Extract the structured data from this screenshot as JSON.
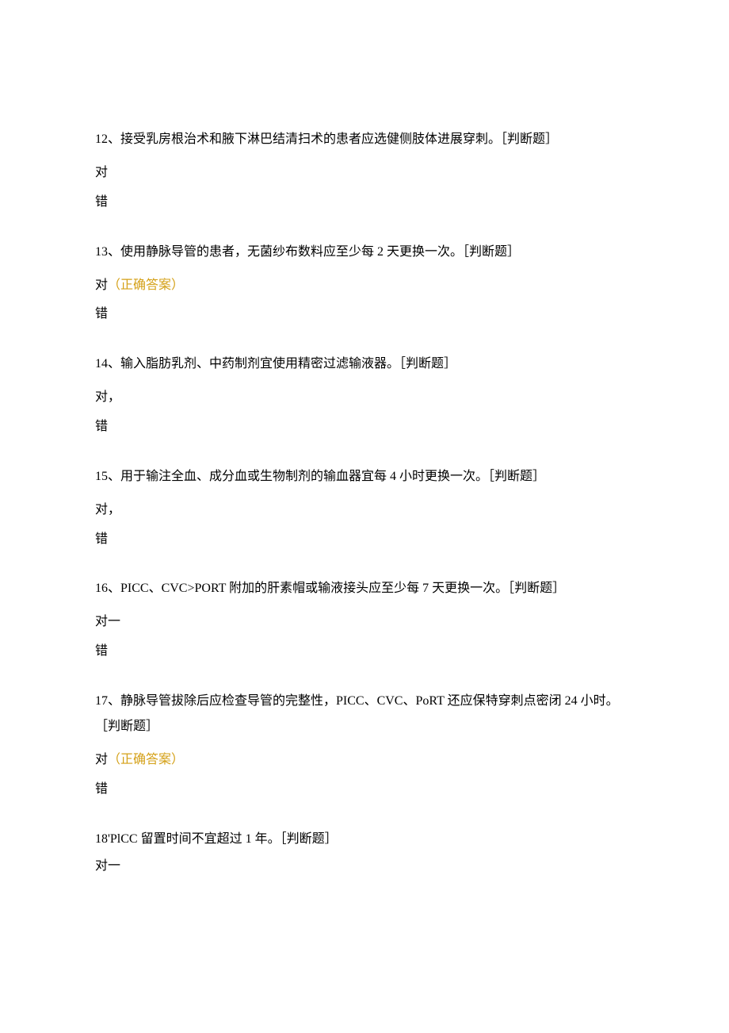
{
  "q12": {
    "text": "12、接受乳房根治术和腋下淋巴结清扫术的患者应选健侧肢体进展穿刺。［判断题］",
    "opt_true": "对",
    "opt_false": "错"
  },
  "q13": {
    "text": "13、使用静脉导管的患者，无菌纱布数料应至少每 2 天更换一次。［判断题］",
    "opt_true": "对",
    "correct": "（正确答案）",
    "opt_false": "错"
  },
  "q14": {
    "text": "14、输入脂肪乳剂、中药制剂宜使用精密过滤输液器。［判断题］",
    "opt_true": "对，",
    "opt_false": "错"
  },
  "q15": {
    "text": "15、用于输注全血、成分血或生物制剂的输血器宜每 4 小时更换一次。［判断题］",
    "opt_true": "对，",
    "opt_false": "错"
  },
  "q16": {
    "text": "16、PICC、CVC>PORT 附加的肝素帽或输液接头应至少每 7 天更换一次。［判断题］",
    "opt_true": "对一",
    "opt_false": "错"
  },
  "q17": {
    "text": "17、静脉导管拔除后应检查导管的完整性，PICC、CVC、PoRT 还应保特穿刺点密闭 24 小时。［判断题］",
    "opt_true": "对",
    "correct": "（正确答案）",
    "opt_false": "错"
  },
  "q18": {
    "text": "18'PlCC 留置时间不宜超过 1 年。［判断题］",
    "opt_true": "对一"
  }
}
